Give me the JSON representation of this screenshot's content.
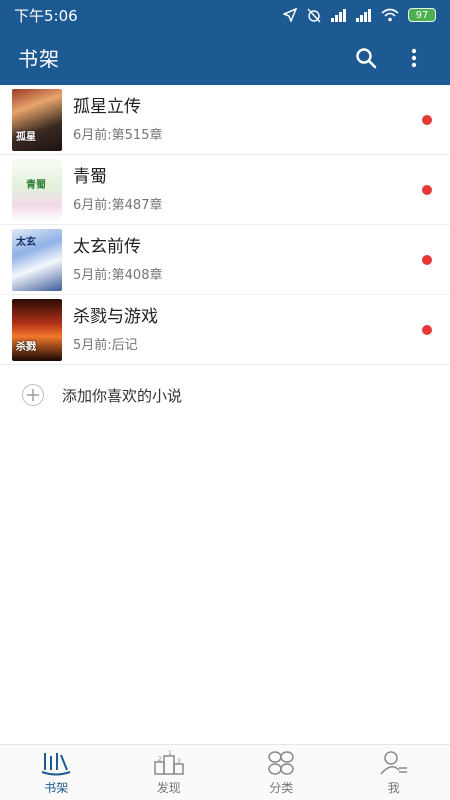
{
  "status_bar": {
    "time": "下午5:06",
    "battery": "97"
  },
  "app_bar": {
    "title": "书架",
    "icons": [
      "search-icon",
      "more-vertical-icon"
    ]
  },
  "books": [
    {
      "title": "孤星立传",
      "meta": "6月前:第515章",
      "cover_text": "孤星",
      "unread": true
    },
    {
      "title": "青蜀",
      "meta": "6月前:第487章",
      "cover_text": "青蜀",
      "unread": true
    },
    {
      "title": "太玄前传",
      "meta": "5月前:第408章",
      "cover_text": "太玄",
      "unread": true
    },
    {
      "title": "杀戮与游戏",
      "meta": "5月前:后记",
      "cover_text": "杀戮",
      "unread": true
    }
  ],
  "add_book": {
    "label": "添加你喜欢的小说"
  },
  "tabs": [
    {
      "label": "书架",
      "icon": "bookshelf-icon",
      "active": true
    },
    {
      "label": "发现",
      "icon": "ranking-podium-icon",
      "active": false
    },
    {
      "label": "分类",
      "icon": "category-grid-icon",
      "active": false
    },
    {
      "label": "我",
      "icon": "profile-icon",
      "active": false
    }
  ],
  "colors": {
    "primary": "#1d5a94",
    "unread_dot": "#e53935",
    "battery": "#4caf50"
  }
}
